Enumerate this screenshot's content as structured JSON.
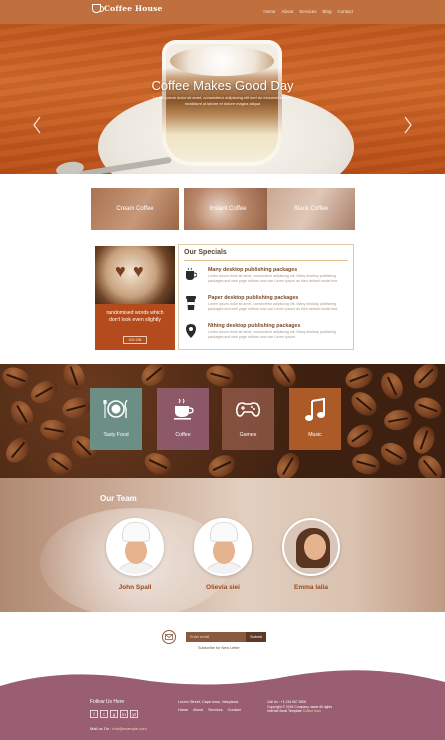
{
  "header": {
    "logo_text": "Coffee House",
    "nav": [
      "Home",
      "About",
      "Services",
      "Blog",
      "Contact"
    ]
  },
  "hero": {
    "title": "Coffee Makes Good Day",
    "subtitle": "Lorem ipsum dolor sit amet, consectetur adipiscing elit sed do eiusmod tempor incididunt ut labore et dolore magna aliqua"
  },
  "categories": [
    "Cream Coffee",
    "Instant Coffee",
    "Black Coffee"
  ],
  "promo": {
    "text": "randomised words which don't look even slightly",
    "button": "GO ON"
  },
  "specials": {
    "title": "Our Specials",
    "items": [
      {
        "icon": "coffee-cup-icon",
        "title": "Many desktop publishing packages",
        "text": "Lorem ipsum dolor sit amet, consectetur adipiscing elit. Many desktop publishing packages and web page editors now use Lorem Ipsum as their default model text."
      },
      {
        "icon": "takeaway-cup-icon",
        "title": "Paper desktop publishing packages",
        "text": "Lorem ipsum dolor sit amet, consectetur adipiscing elit. Many desktop publishing packages and web page editors now use Lorem Ipsum as their default model text."
      },
      {
        "icon": "location-pin-icon",
        "title": "Nthing desktop publishing packages",
        "text": "Lorem ipsum dolor sit amet, consectetur adipiscing elit. Many desktop publishing packages and web page editors now use Lorem Ipsum."
      }
    ]
  },
  "services": [
    {
      "label": "Tasty Food",
      "icon": "plate-cutlery-icon"
    },
    {
      "label": "Coffee",
      "icon": "coffee-cup-icon"
    },
    {
      "label": "Games",
      "icon": "gamepad-icon"
    },
    {
      "label": "Music",
      "icon": "music-note-icon"
    }
  ],
  "team": {
    "title": "Our Team",
    "members": [
      "John Spall",
      "Olievia siei",
      "Emma lalia"
    ]
  },
  "newsletter": {
    "placeholder": "Enter email",
    "button": "Submit",
    "label": "Subscribe for New Letter"
  },
  "footer": {
    "follow": "Follow Us Here",
    "social": [
      "f",
      "t",
      "g",
      "in",
      "yt"
    ],
    "mail_label": "Mail us On :",
    "mail_value": "info@example.com",
    "address": "Lorem Street, Cape town, Maryland.",
    "links": [
      "Home",
      "About",
      "Services",
      "Contact"
    ],
    "call": "Call Us : +1 234 567 8900",
    "copyright": "Copyright © 2016 Company name All rights",
    "credit_label": "Internet Book Template",
    "credit_link": "Collect from"
  },
  "colors": {
    "header": "#c0703f",
    "accent": "#b44b1c",
    "footer": "#9a5e73",
    "service_food": "#6c968e",
    "service_coffee": "#96607a",
    "service_games": "#925a48",
    "service_music": "#b4602a"
  }
}
